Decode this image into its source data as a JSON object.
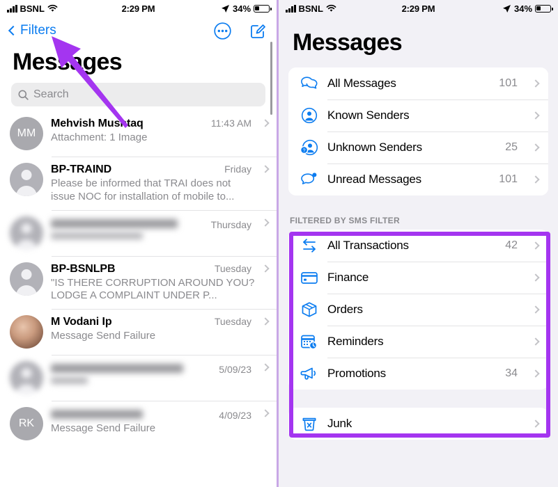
{
  "left_phone": {
    "status_bar": {
      "carrier": "BSNL",
      "time": "2:29 PM",
      "battery_percent": "34%",
      "signal_icon": "cellular-bars-icon",
      "wifi_icon": "wifi-icon",
      "location_icon": "location-arrow-icon",
      "battery_icon": "battery-icon"
    },
    "nav": {
      "back_label": "Filters",
      "back_icon": "chevron-left-icon",
      "more_icon": "more-circle-icon",
      "compose_icon": "compose-icon"
    },
    "title": "Messages",
    "search": {
      "placeholder": "Search",
      "icon": "search-icon"
    },
    "conversations": [
      {
        "avatar_type": "initials",
        "initials": "MM",
        "name": "Mehvish Mushtaq",
        "time": "11:43 AM",
        "preview": "Attachment: 1 Image",
        "blurred": false
      },
      {
        "avatar_type": "silhouette",
        "initials": "",
        "name": "BP-TRAIND",
        "time": "Friday",
        "preview": "Please be informed that TRAI does not issue NOC for installation of mobile to...",
        "blurred": false
      },
      {
        "avatar_type": "silhouette",
        "initials": "",
        "name": "",
        "time": "Thursday",
        "preview": "",
        "blurred": true
      },
      {
        "avatar_type": "silhouette",
        "initials": "",
        "name": "BP-BSNLPB",
        "time": "Tuesday",
        "preview": "\"IS THERE CORRUPTION AROUND YOU? LODGE A COMPLAINT UNDER P...",
        "blurred": false
      },
      {
        "avatar_type": "photo",
        "initials": "",
        "name": "M Vodani Ip",
        "time": "Tuesday",
        "preview": "Message Send Failure",
        "blurred": false
      },
      {
        "avatar_type": "silhouette",
        "initials": "",
        "name": "",
        "time": "5/09/23",
        "preview": "",
        "blurred": true
      },
      {
        "avatar_type": "initials",
        "initials": "RK",
        "name": "",
        "time": "4/09/23",
        "preview": "Message Send Failure",
        "blurred": true
      }
    ]
  },
  "right_phone": {
    "status_bar": {
      "carrier": "BSNL",
      "time": "2:29 PM",
      "battery_percent": "34%"
    },
    "title": "Messages",
    "groups": [
      {
        "header": "",
        "rows": [
          {
            "icon": "two-speech-bubbles-icon",
            "label": "All Messages",
            "count": "101"
          },
          {
            "icon": "person-circle-icon",
            "label": "Known Senders",
            "count": ""
          },
          {
            "icon": "person-question-icon",
            "label": "Unknown Senders",
            "count": "25"
          },
          {
            "icon": "speech-bubble-dot-icon",
            "label": "Unread Messages",
            "count": "101"
          }
        ]
      },
      {
        "header": "FILTERED BY SMS FILTER",
        "rows": [
          {
            "icon": "transactions-arrows-icon",
            "label": "All Transactions",
            "count": "42"
          },
          {
            "icon": "credit-card-icon",
            "label": "Finance",
            "count": ""
          },
          {
            "icon": "box-package-icon",
            "label": "Orders",
            "count": ""
          },
          {
            "icon": "calendar-clock-icon",
            "label": "Reminders",
            "count": ""
          },
          {
            "icon": "megaphone-icon",
            "label": "Promotions",
            "count": "34"
          }
        ]
      },
      {
        "header": "",
        "rows": [
          {
            "icon": "junk-trash-x-icon",
            "label": "Junk",
            "count": ""
          }
        ]
      }
    ]
  },
  "annotations": {
    "accent_color": "#a435f0",
    "arrow_name": "purple-arrow-pointing-to-filters",
    "highlight_name": "purple-highlight-sms-filter-section"
  }
}
